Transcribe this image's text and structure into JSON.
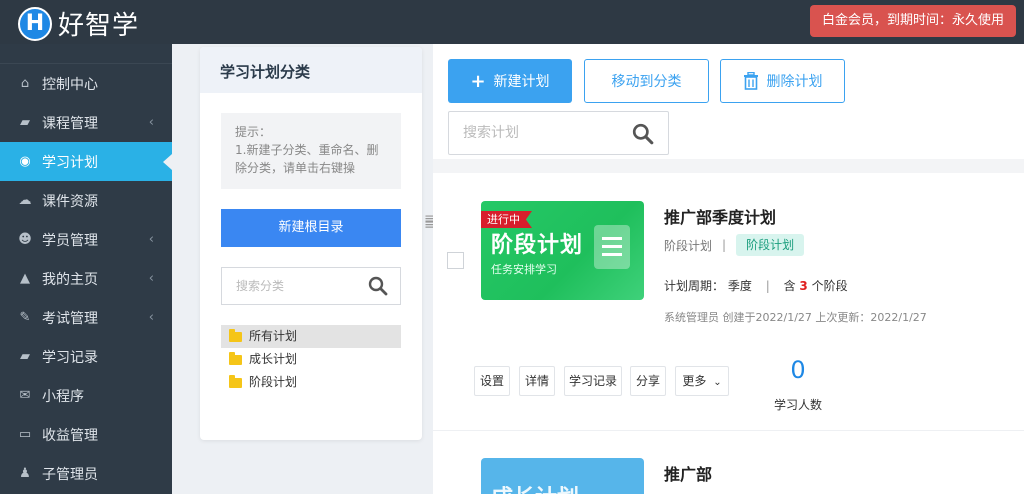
{
  "app": {
    "logo_letter": "H",
    "name": "好智学"
  },
  "header": {
    "membership": "白金会员，到期时间：永久使用"
  },
  "sidebar": {
    "items": [
      {
        "label": "控制中心",
        "icon": "home-icon",
        "glyph": "⌂",
        "has_arrow": false,
        "active": false
      },
      {
        "label": "课程管理",
        "icon": "book-icon",
        "glyph": "▰",
        "has_arrow": true,
        "active": false
      },
      {
        "label": "学习计划",
        "icon": "eye-icon",
        "glyph": "◉",
        "has_arrow": false,
        "active": true
      },
      {
        "label": "课件资源",
        "icon": "cloud-icon",
        "glyph": "☁",
        "has_arrow": false,
        "active": false
      },
      {
        "label": "学员管理",
        "icon": "users-icon",
        "glyph": "☻",
        "has_arrow": true,
        "active": false
      },
      {
        "label": "我的主页",
        "icon": "graduation-icon",
        "glyph": "▲",
        "has_arrow": true,
        "active": false
      },
      {
        "label": "考试管理",
        "icon": "exam-icon",
        "glyph": "✎",
        "has_arrow": true,
        "active": false
      },
      {
        "label": "学习记录",
        "icon": "record-icon",
        "glyph": "▰",
        "has_arrow": false,
        "active": false
      },
      {
        "label": "小程序",
        "icon": "wechat-icon",
        "glyph": "✉",
        "has_arrow": false,
        "active": false
      },
      {
        "label": "收益管理",
        "icon": "card-icon",
        "glyph": "▭",
        "has_arrow": false,
        "active": false
      },
      {
        "label": "子管理员",
        "icon": "admin-icon",
        "glyph": "♟",
        "has_arrow": false,
        "active": false
      }
    ],
    "arrow_glyph": "‹"
  },
  "category": {
    "title": "学习计划分类",
    "tip_title": "提示：",
    "tip_body": "1.新建子分类、重命名、删除分类，请单击右键操",
    "new_root_label": "新建根目录",
    "search_placeholder": "搜索分类",
    "tree": [
      {
        "label": "所有计划",
        "selected": true
      },
      {
        "label": "成长计划",
        "selected": false
      },
      {
        "label": "阶段计划",
        "selected": false
      }
    ]
  },
  "toolbar": {
    "new_plan": "新建计划",
    "move": "移动到分类",
    "delete": "删除计划",
    "search_placeholder": "搜索计划"
  },
  "plans": [
    {
      "status_tag": "进行中",
      "thumb_title": "阶段计划",
      "thumb_sub": "任务安排学习",
      "title": "推广部季度计划",
      "category": "阶段计划",
      "tag": "阶段计划",
      "period_label": "计划周期：",
      "period_value": "季度",
      "stages_prefix": "含",
      "stages_count": "3",
      "stages_suffix": "个阶段",
      "info": "系统管理员 创建于2022/1/27 上次更新：2022/1/27",
      "actions": [
        "设置",
        "详情",
        "学习记录",
        "分享",
        "更多"
      ],
      "learner_count": "0",
      "learner_label": "学习人数"
    },
    {
      "thumb_title": "成长计划",
      "title": "推广部"
    }
  ],
  "colors": {
    "primary": "#3ba2f0",
    "sidebar_bg": "#2f3b47",
    "active": "#2ab1e6",
    "danger": "#d9534f",
    "thumb_green": "#25c866"
  }
}
